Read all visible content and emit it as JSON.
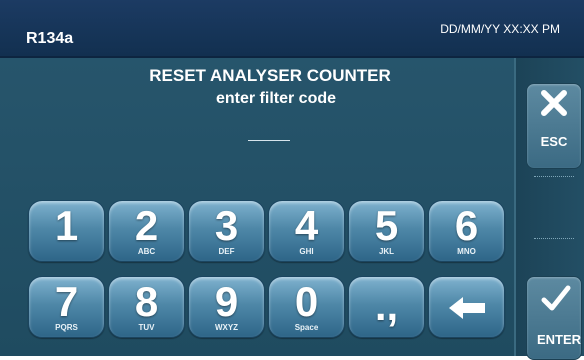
{
  "header": {
    "refrigerant": "R134a",
    "datetime": "DD/MM/YY XX:XX PM"
  },
  "main": {
    "title": "RESET ANALYSER COUNTER",
    "subtitle": "enter filter code",
    "code_value": ""
  },
  "keypad": {
    "keys": [
      {
        "label": "1",
        "sub": ""
      },
      {
        "label": "2",
        "sub": "ABC"
      },
      {
        "label": "3",
        "sub": "DEF"
      },
      {
        "label": "4",
        "sub": "GHI"
      },
      {
        "label": "5",
        "sub": "JKL"
      },
      {
        "label": "6",
        "sub": "MNO"
      },
      {
        "label": "7",
        "sub": "PQRS"
      },
      {
        "label": "8",
        "sub": "TUV"
      },
      {
        "label": "9",
        "sub": "WXYZ"
      },
      {
        "label": "0",
        "sub": "Space"
      },
      {
        "label": ".,",
        "sub": ""
      }
    ],
    "backspace_icon": "backspace-arrow-icon"
  },
  "side": {
    "esc_label": "ESC",
    "esc_icon": "close-x-icon",
    "enter_label": "ENTER",
    "enter_icon": "check-icon"
  },
  "colors": {
    "header_bg": "#1c3b63",
    "screen_bg": "#245268",
    "key_face": "#4f88a8"
  }
}
